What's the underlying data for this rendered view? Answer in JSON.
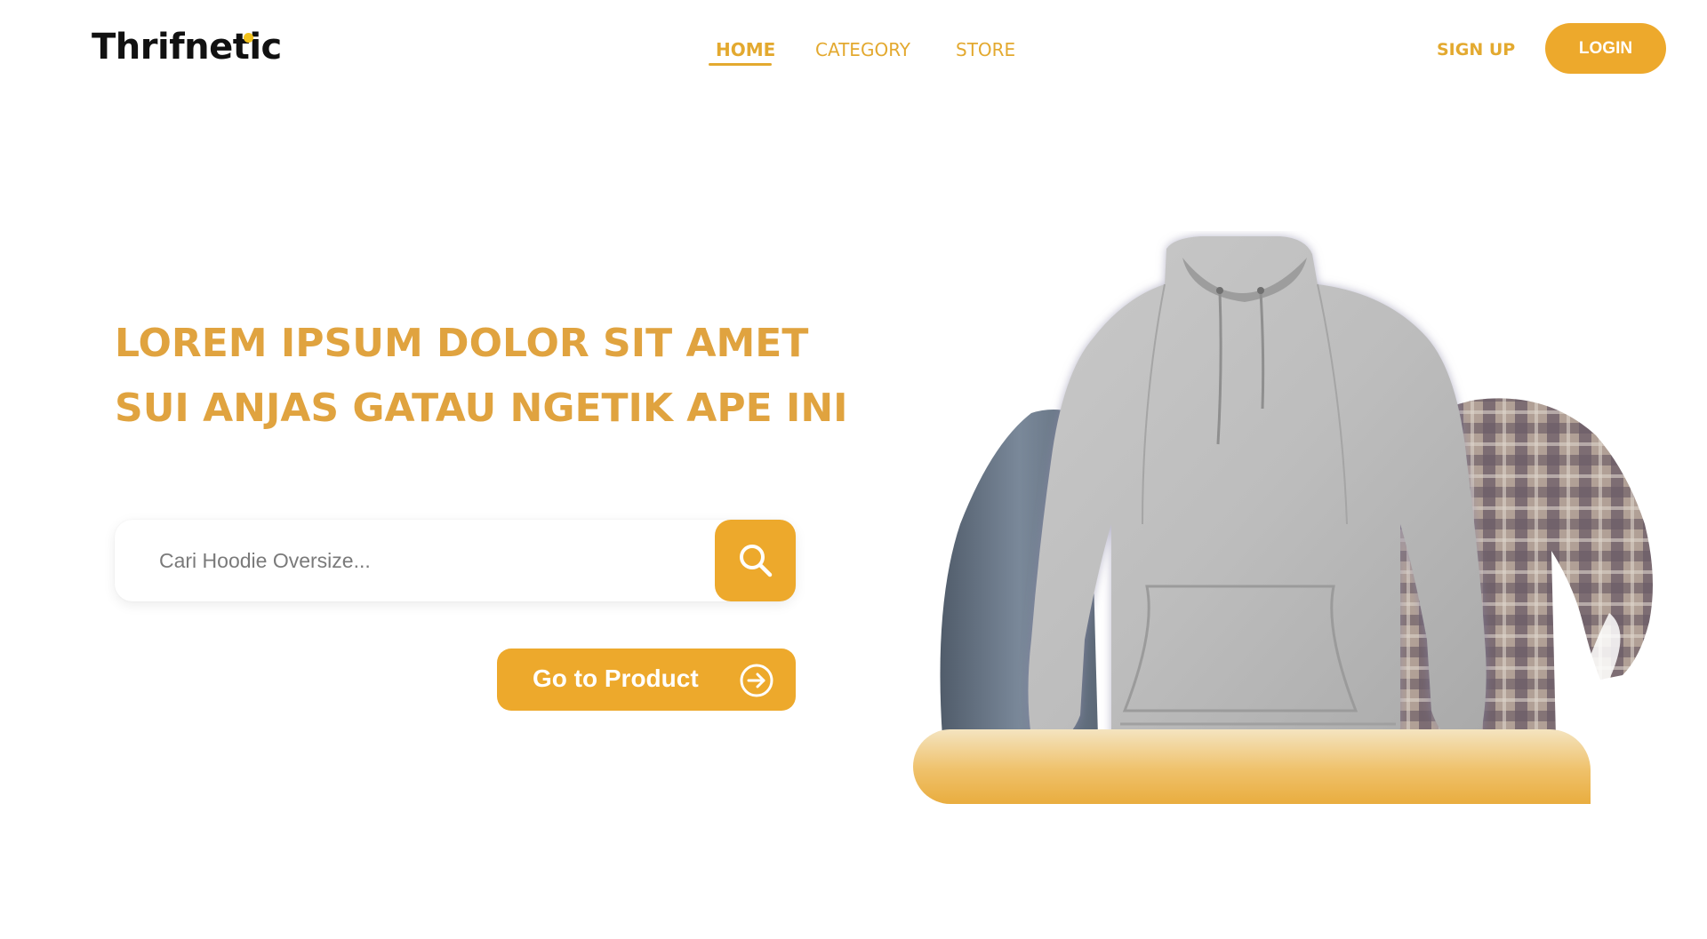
{
  "brand": {
    "name": "Thrifnetic",
    "dot_color": "#f2c21c"
  },
  "nav": {
    "items": [
      {
        "label": "HOME",
        "active": true
      },
      {
        "label": "CATEGORY",
        "active": false
      },
      {
        "label": "STORE",
        "active": false
      }
    ]
  },
  "auth": {
    "signup_label": "SIGN UP",
    "login_label": "LOGIN"
  },
  "hero": {
    "title_lines": [
      "LOREM IPSUM DOLOR SIT AMET",
      "SUI ANJAS GATAU NGETIK APE INI"
    ],
    "search": {
      "placeholder": "Cari Hoodie Oversize...",
      "value": "",
      "icon": "search-icon"
    },
    "cta": {
      "label": "Go to Product",
      "icon": "arrow-right-circle-icon"
    },
    "image_items": [
      "jeans",
      "hoodie",
      "flannel-shirt"
    ]
  },
  "colors": {
    "accent": "#eda92c",
    "title": "#e0a33f",
    "nav_text": "#e3a92f"
  }
}
